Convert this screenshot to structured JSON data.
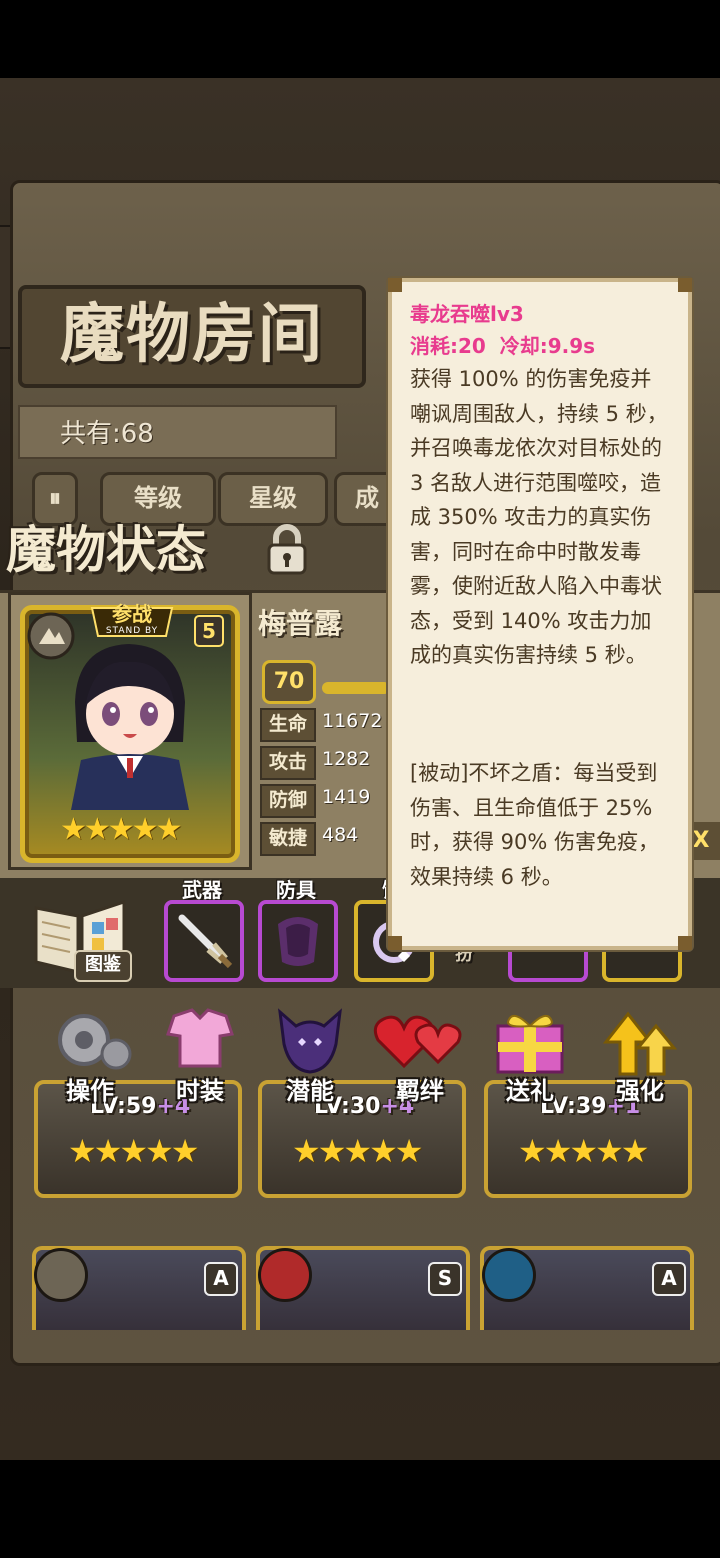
{
  "room_title": "魔物房间",
  "count_label": "共有:68",
  "sort_buttons": [
    "等级",
    "星级",
    "成"
  ],
  "status_title": "魔物状态",
  "character": {
    "standby_label": "参战",
    "standby_sub": "STAND BY",
    "grade": "5",
    "stars": "★★★★★",
    "name": "梅普露",
    "level": "70",
    "stats": [
      {
        "name": "生命",
        "value": "11672"
      },
      {
        "name": "攻击",
        "value": "1282"
      },
      {
        "name": "防御",
        "value": "1419"
      },
      {
        "name": "敏捷",
        "value": "484"
      }
    ]
  },
  "equipment": {
    "codex_label": "图鉴",
    "slots": [
      "武器",
      "防具",
      "饰"
    ],
    "hidden_label": "扮"
  },
  "actions": [
    "操作",
    "时装",
    "潜能",
    "羁绊",
    "送礼",
    "强化"
  ],
  "cards": [
    {
      "level": "LV:59",
      "bonus": "+4",
      "stars": "★★★★★"
    },
    {
      "level": "LV:30",
      "bonus": "+4",
      "stars": "★★★★★"
    },
    {
      "level": "LV:39",
      "bonus": "+1",
      "stars": "★★★★★"
    }
  ],
  "cards_row2": [
    {
      "grade": "A"
    },
    {
      "grade": "S"
    },
    {
      "grade": "A"
    }
  ],
  "side_label": "X",
  "tooltip": {
    "title": "毒龙吞噬lv3",
    "cost": "消耗:20  冷却:9.9s",
    "description": "获得 100% 的伤害免疫并嘲讽周围敌人，持续 5 秒，并召唤毒龙依次对目标处的 3 名敌人进行范围噬咬，造成 350% 攻击力的真实伤害，同时在命中时散发毒雾，使附近敌人陷入中毒状态，受到 140% 攻击力加成的真实伤害持续 5 秒。",
    "passive": "[被动]不坏之盾：每当受到伤害、且生命值低于 25% 时，获得 90% 伤害免疫，效果持续 6 秒。"
  },
  "colors": {
    "tooltip_title": "#e83b8e",
    "gold_frame": "#d9b52c",
    "equip_border": "#b74ad1"
  }
}
